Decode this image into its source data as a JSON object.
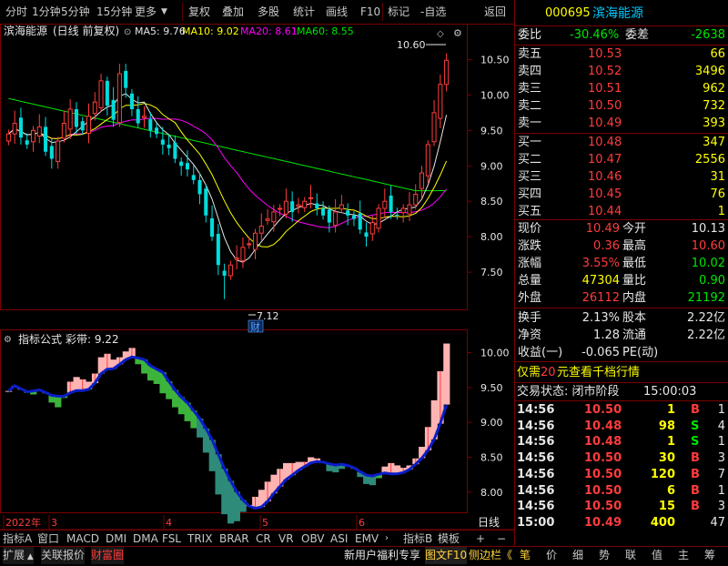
{
  "toolbar": {
    "period_tabs": [
      "分时",
      "1分钟",
      "5分钟",
      "15分钟",
      "更多"
    ],
    "tools": [
      "复权",
      "叠加",
      "多股",
      "统计",
      "画线",
      "F10",
      "标记",
      "-自选",
      "返回"
    ]
  },
  "chart": {
    "stock_name": "滨海能源",
    "period_label": "(日线 前复权)",
    "ma": [
      {
        "label": "MA5: 9.76",
        "color": "#e6e6e6"
      },
      {
        "label": "MA10: 9.02",
        "color": "#ffff00"
      },
      {
        "label": "MA20: 8.61",
        "color": "#ff00ff"
      },
      {
        "label": "MA60: 8.55",
        "color": "#00e600"
      }
    ],
    "price_axis": [
      "10.50",
      "10.00",
      "9.50",
      "9.00",
      "8.50",
      "8.00",
      "7.50"
    ],
    "high_marker": "10.60",
    "low_marker": "7.12",
    "finance_icon": "财",
    "indicator_title": "指标公式",
    "indicator_name": "彩带: 9.22",
    "indicator_axis": [
      "10.00",
      "9.50",
      "9.00",
      "8.50",
      "8.00"
    ],
    "date_axis": [
      {
        "label": "2022年",
        "color": "#ff3c3c"
      },
      {
        "label": "3",
        "color": "#ff3c3c"
      },
      {
        "label": "4",
        "color": "#ff3c3c"
      },
      {
        "label": "5",
        "color": "#ff3c3c"
      },
      {
        "label": "6",
        "color": "#ff3c3c"
      }
    ],
    "period_corner": "日线"
  },
  "chart_data": {
    "type": "candlestick",
    "title": "滨海能源",
    "ylim": [
      7.0,
      10.75
    ],
    "high": 10.6,
    "low": 7.12,
    "month_ticks": [
      "3",
      "4",
      "5",
      "6"
    ],
    "close_series": [
      9.45,
      9.6,
      9.4,
      9.3,
      9.5,
      9.55,
      9.2,
      9.1,
      9.35,
      9.6,
      9.8,
      9.55,
      9.5,
      9.7,
      9.9,
      10.2,
      9.85,
      9.65,
      10.3,
      10.1,
      9.8,
      9.6,
      9.7,
      9.5,
      9.45,
      9.3,
      9.25,
      9.1,
      9.0,
      8.95,
      8.8,
      8.6,
      8.3,
      8.0,
      7.6,
      7.45,
      7.6,
      7.7,
      7.85,
      7.9,
      8.05,
      8.15,
      8.25,
      8.35,
      8.4,
      8.5,
      8.35,
      8.45,
      8.5,
      8.55,
      8.4,
      8.3,
      8.2,
      8.35,
      8.45,
      8.3,
      8.25,
      8.1,
      8.0,
      8.2,
      8.4,
      8.5,
      8.35,
      8.3,
      8.4,
      8.45,
      8.6,
      8.9,
      9.3,
      9.75,
      10.15,
      10.49
    ]
  },
  "quote": {
    "code": "000695",
    "name": "滨海能源",
    "weibi_label": "委比",
    "weibi_value": "-30.46%",
    "weicha_label": "委差",
    "weicha_value": "-2638",
    "asks": [
      {
        "label": "卖五",
        "price": "10.53",
        "vol": "66"
      },
      {
        "label": "卖四",
        "price": "10.52",
        "vol": "3496"
      },
      {
        "label": "卖三",
        "price": "10.51",
        "vol": "962"
      },
      {
        "label": "卖二",
        "price": "10.50",
        "vol": "732"
      },
      {
        "label": "卖一",
        "price": "10.49",
        "vol": "393"
      }
    ],
    "bids": [
      {
        "label": "买一",
        "price": "10.48",
        "vol": "347"
      },
      {
        "label": "买二",
        "price": "10.47",
        "vol": "2556"
      },
      {
        "label": "买三",
        "price": "10.46",
        "vol": "31"
      },
      {
        "label": "买四",
        "price": "10.45",
        "vol": "76"
      },
      {
        "label": "买五",
        "price": "10.44",
        "vol": "1"
      }
    ],
    "stats": [
      {
        "l1": "现价",
        "v1": "10.49",
        "c1": "red",
        "l2": "今开",
        "v2": "10.13",
        "c2": "white"
      },
      {
        "l1": "涨跌",
        "v1": "0.36",
        "c1": "red",
        "l2": "最高",
        "v2": "10.60",
        "c2": "red"
      },
      {
        "l1": "涨幅",
        "v1": "3.55%",
        "c1": "red",
        "l2": "最低",
        "v2": "10.02",
        "c2": "green"
      },
      {
        "l1": "总量",
        "v1": "47304",
        "c1": "yellow",
        "l2": "量比",
        "v2": "0.90",
        "c2": "green"
      },
      {
        "l1": "外盘",
        "v1": "26112",
        "c1": "red",
        "l2": "内盘",
        "v2": "21192",
        "c2": "green"
      }
    ],
    "stats2": [
      {
        "l1": "换手",
        "v1": "2.13%",
        "l2": "股本",
        "v2": "2.22亿"
      },
      {
        "l1": "净资",
        "v1": "1.28",
        "l2": "流通",
        "v2": "2.22亿"
      },
      {
        "l1": "收益(一)",
        "v1": "-0.065",
        "l2": "PE(动)",
        "v2": ""
      }
    ],
    "promo_prefix": "仅需",
    "promo_amount": "20",
    "promo_suffix": "元查看千档行情",
    "status_label": "交易状态: 闭市阶段",
    "status_time": "15:00:03",
    "ticks": [
      {
        "time": "14:56",
        "price": "10.50",
        "vol": "1",
        "bs": "B",
        "n": "1"
      },
      {
        "time": "14:56",
        "price": "10.48",
        "vol": "98",
        "bs": "S",
        "n": "4"
      },
      {
        "time": "14:56",
        "price": "10.48",
        "vol": "1",
        "bs": "S",
        "n": "1"
      },
      {
        "time": "14:56",
        "price": "10.50",
        "vol": "30",
        "bs": "B",
        "n": "3"
      },
      {
        "time": "14:56",
        "price": "10.50",
        "vol": "120",
        "bs": "B",
        "n": "7"
      },
      {
        "time": "14:56",
        "price": "10.50",
        "vol": "6",
        "bs": "B",
        "n": "1"
      },
      {
        "time": "14:56",
        "price": "10.50",
        "vol": "15",
        "bs": "B",
        "n": "3"
      },
      {
        "time": "15:00",
        "price": "10.49",
        "vol": "400",
        "bs": "",
        "n": "47"
      }
    ]
  },
  "indicator_tabs": [
    "指标A",
    "窗口",
    "MACD",
    "DMI",
    "DMA",
    "FSL",
    "TRIX",
    "BRAR",
    "CR",
    "VR",
    "OBV",
    "ASI",
    "EMV"
  ],
  "indicator_tabs_right": [
    "指标B",
    "模板",
    "+",
    "−"
  ],
  "bottom_left": [
    "扩展",
    "关联报价",
    "财富圈"
  ],
  "bottom_mid": [
    "新用户福利专享",
    "图文F10",
    "侧边栏《"
  ],
  "bottom_right": [
    "笔",
    "价",
    "细",
    "势",
    "联",
    "值",
    "主",
    "筹"
  ]
}
